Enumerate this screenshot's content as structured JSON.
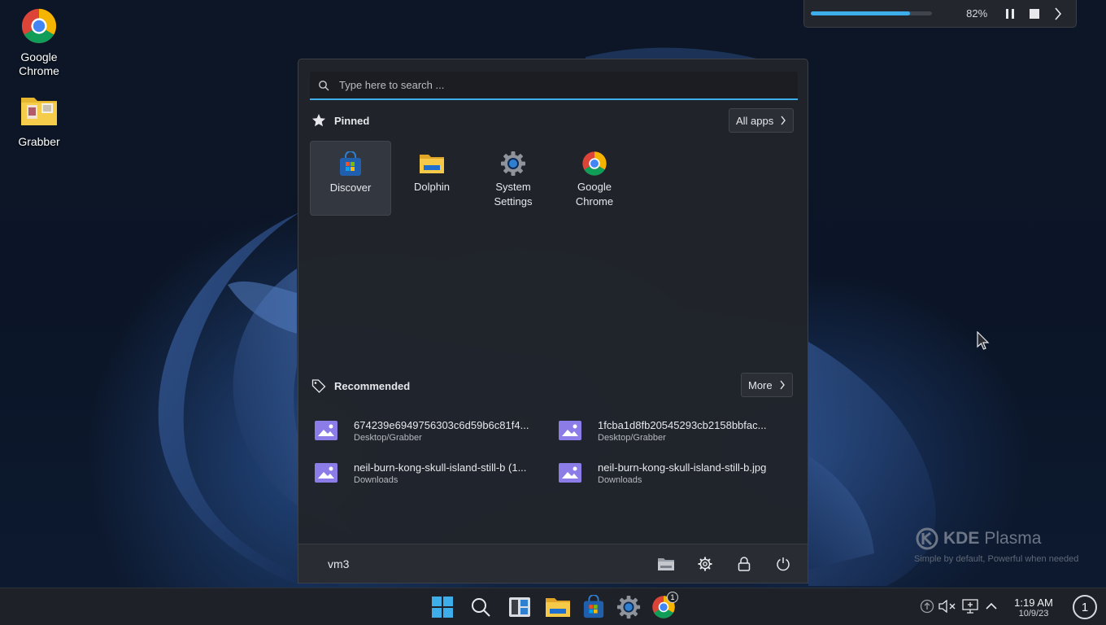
{
  "desktop": {
    "icons": [
      {
        "label": "Google\nChrome",
        "line1": "Google",
        "line2": "Chrome"
      },
      {
        "label": "Grabber"
      }
    ]
  },
  "progress_widget": {
    "percent_label": "82%",
    "fraction": 0.82
  },
  "start_menu": {
    "search": {
      "placeholder": "Type here to search ..."
    },
    "pinned": {
      "title": "Pinned",
      "all_apps_label": "All apps",
      "apps": [
        {
          "name": "Discover",
          "icon": "discover-icon"
        },
        {
          "name": "Dolphin",
          "icon": "folder-icon"
        },
        {
          "name": "System Settings",
          "line1": "System",
          "line2": "Settings",
          "icon": "gear-icon"
        },
        {
          "name": "Google Chrome",
          "line1": "Google",
          "line2": "Chrome",
          "icon": "chrome-icon"
        }
      ]
    },
    "recommended": {
      "title": "Recommended",
      "more_label": "More",
      "items": [
        {
          "name": "674239e6949756303c6d59b6c81f4...",
          "path": "Desktop/Grabber"
        },
        {
          "name": "1fcba1d8fb20545293cb2158bbfac...",
          "path": "Desktop/Grabber"
        },
        {
          "name": "neil-burn-kong-skull-island-still-b (1...",
          "path": "Downloads"
        },
        {
          "name": "neil-burn-kong-skull-island-still-b.jpg",
          "path": "Downloads"
        }
      ]
    },
    "footer": {
      "user": "vm3",
      "buttons": [
        "file-manager-icon",
        "settings-icon",
        "lock-icon",
        "power-icon"
      ]
    }
  },
  "watermark": {
    "brand": "KDE",
    "product": "Plasma",
    "tagline": "Simple by default, Powerful when  needed"
  },
  "taskbar": {
    "apps": [
      "start-icon",
      "search-icon",
      "widgets-icon",
      "folder-icon",
      "discover-icon",
      "settings-icon",
      "chrome-icon"
    ],
    "chrome_badge": "1",
    "clock": {
      "time": "1:19 AM",
      "date": "10/9/23"
    },
    "virtual_desktop": "1"
  },
  "colors": {
    "accent": "#3daee9",
    "panel": "#21242a",
    "taskbar": "#1e2127"
  }
}
